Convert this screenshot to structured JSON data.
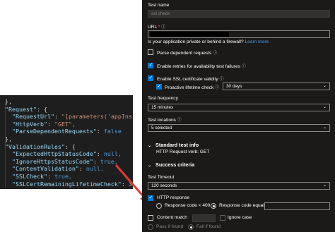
{
  "code": {
    "lines": [
      {
        "pre": "},",
        "tokens": []
      },
      {
        "pre": "",
        "key": "\"Request\"",
        "rest": ": {"
      },
      {
        "pre": "  ",
        "key": "\"RequestUrl\"",
        "rest": ": ",
        "val": "\"[parameters('appInsights"
      },
      {
        "pre": "  ",
        "key": "\"HttpVerb\"",
        "rest": ": ",
        "val": "\"GET\","
      },
      {
        "pre": "  ",
        "key": "\"ParseDependentRequests\"",
        "rest": ": ",
        "bool": "false"
      },
      {
        "pre": "},",
        "tokens": []
      },
      {
        "pre": "",
        "key": "\"ValidationRules\"",
        "rest": ": {"
      },
      {
        "pre": "  ",
        "key": "\"ExpectedHttpStatusCode\"",
        "rest": ": ",
        "bool": "null,"
      },
      {
        "pre": "  ",
        "key": "\"IgnoreHttpsStatusCode\"",
        "rest": ": ",
        "bool": "true,"
      },
      {
        "pre": "  ",
        "key": "\"ContentValidation\"",
        "rest": ": ",
        "bool": "null,"
      },
      {
        "pre": "  ",
        "key": "\"SSLCheck\"",
        "rest": ": ",
        "bool": "true,"
      },
      {
        "pre": "  ",
        "key": "\"SSLCertRemainingLifetimeCheck\"",
        "rest": ": ",
        "num": "30"
      },
      {
        "pre": "}",
        "tokens": []
      },
      {
        "pre": "}",
        "tokens": []
      }
    ]
  },
  "form": {
    "test_name_label": "Test name",
    "test_name_value": "ssl check",
    "url_label": "URL",
    "url_required": "*",
    "info_glyph": "ⓘ",
    "firewall_text": "Is your application private or behind a firewall?",
    "learn_more": "Learn more",
    "parse_dependent": "Parse dependent requests",
    "enable_retries": "Enable retries for availability test failures",
    "enable_ssl": "Enable SSL certificate validity",
    "proactive": "Proactive lifetime check",
    "proactive_value": "30 days",
    "test_frequency_label": "Test frequency",
    "test_frequency_value": "15 minutes",
    "test_locations_label": "Test locations",
    "test_locations_value": "5 selected",
    "standard_test_info": "Standard test info",
    "http_verb": "HTTP Request verb: GET",
    "success_criteria": "Success criteria",
    "test_timeout_label": "Test Timeout",
    "test_timeout_value": "120 seconds",
    "http_response": "HTTP response",
    "response_lt": "Response code < 400",
    "response_equals": "Response code equals:",
    "content_match": "Content match",
    "ignore_case": "Ignore case",
    "pass_if_found": "Pass if found",
    "fail_if_found": "Fail if found"
  },
  "colors": {
    "accent": "#0078d4",
    "arrow": "#e53935"
  }
}
